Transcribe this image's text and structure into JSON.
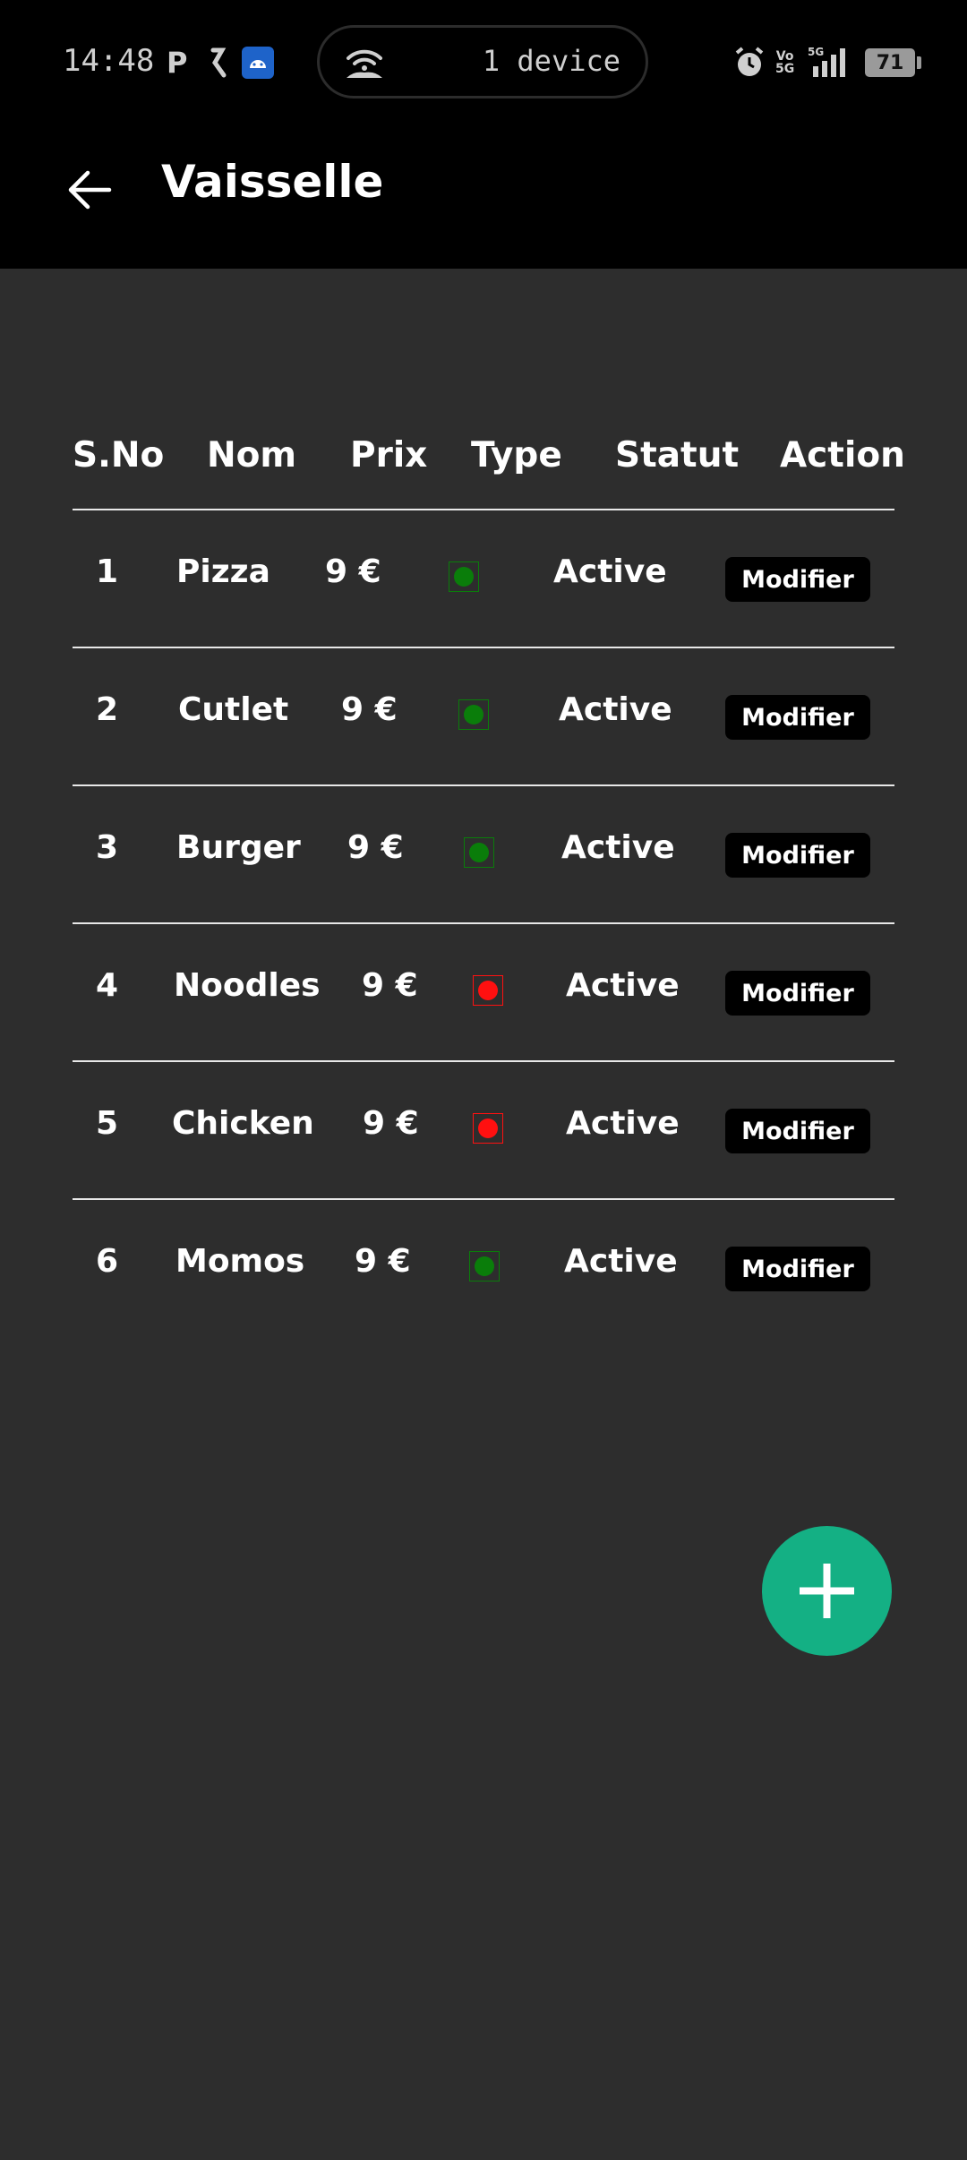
{
  "status_bar": {
    "time": "14:48",
    "pill_text": "1 device",
    "battery": "71",
    "net_label": "5G"
  },
  "header": {
    "title": "Vaisselle"
  },
  "table": {
    "columns": [
      "S.No",
      "Nom",
      "Prix",
      "Type",
      "Statut",
      "Action"
    ],
    "rows": [
      {
        "sno": "1",
        "name": "Pizza",
        "price": "9 €",
        "type": "veg",
        "status": "Active",
        "action": "Modifier"
      },
      {
        "sno": "2",
        "name": "Cutlet",
        "price": "9 €",
        "type": "veg",
        "status": "Active",
        "action": "Modifier"
      },
      {
        "sno": "3",
        "name": "Burger",
        "price": "9 €",
        "type": "veg",
        "status": "Active",
        "action": "Modifier"
      },
      {
        "sno": "4",
        "name": "Noodles",
        "price": "9 €",
        "type": "non-veg",
        "status": "Active",
        "action": "Modifier"
      },
      {
        "sno": "5",
        "name": "Chicken",
        "price": "9 €",
        "type": "non-veg",
        "status": "Active",
        "action": "Modifier"
      },
      {
        "sno": "6",
        "name": "Momos",
        "price": "9 €",
        "type": "veg",
        "status": "Active",
        "action": "Modifier"
      }
    ]
  },
  "colors": {
    "veg": "#0a7d0a",
    "non_veg": "#ff1010",
    "fab": "#14b084",
    "background": "#2d2d2d",
    "bar": "#000000"
  },
  "icons": {
    "back": "arrow-left-icon",
    "fab": "plus-icon"
  }
}
